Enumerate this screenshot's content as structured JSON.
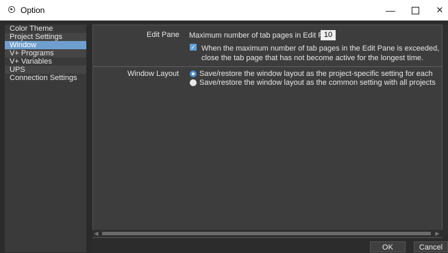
{
  "window": {
    "title": "Option",
    "icon": "option-icon",
    "minimize_glyph": "—",
    "close_glyph": "✕"
  },
  "sidebar": {
    "items": [
      {
        "label": "Color Theme"
      },
      {
        "label": "Project Settings"
      },
      {
        "label": "Window"
      },
      {
        "label": "V+ Programs"
      },
      {
        "label": "V+ Variables"
      },
      {
        "label": "UPS"
      },
      {
        "label": "Connection Settings"
      }
    ],
    "selected": "Window"
  },
  "edit_pane": {
    "section_label": "Edit Pane",
    "max_tabs_label": "Maximum number of tab pages in Edit Pane",
    "max_tabs_value": "10",
    "close_tab_checked": true,
    "close_tab_text_line1": "When the maximum number of tab pages in the Edit Pane is exceeded,",
    "close_tab_text_line2": "close the tab page that has not become active for the longest time."
  },
  "window_layout": {
    "section_label": "Window Layout",
    "option1": "Save/restore the window layout as the project-specific setting for each",
    "option2": "Save/restore the window layout as the common setting with all projects",
    "selected": "option1"
  },
  "buttons": {
    "ok": "OK",
    "cancel": "Cancel"
  },
  "colors": {
    "accent": "#5f9fd9",
    "selection": "#6f9fcf",
    "background": "#2c2c2c"
  }
}
